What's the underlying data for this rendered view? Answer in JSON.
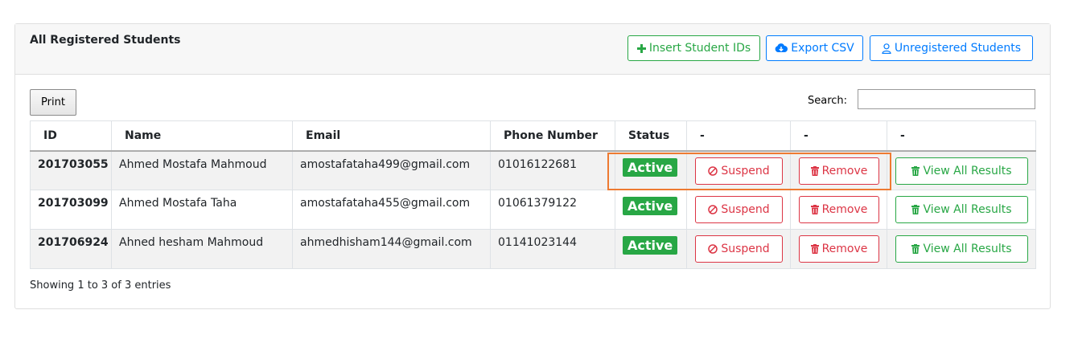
{
  "header": {
    "title": "All Registered Students",
    "buttons": {
      "insert": "Insert Student IDs",
      "export": "Export CSV",
      "unregistered": "Unregistered Students"
    }
  },
  "toolbar": {
    "print": "Print",
    "search_label": "Search:",
    "search_value": ""
  },
  "table": {
    "columns": [
      "ID",
      "Name",
      "Email",
      "Phone Number",
      "Status",
      "-",
      "-",
      "-"
    ],
    "rows": [
      {
        "id": "201703055",
        "name": "Ahmed Mostafa Mahmoud",
        "email": "amostafataha499@gmail.com",
        "phone": "01016122681",
        "status": "Active",
        "suspend": "Suspend",
        "remove": "Remove",
        "view": "View All Results"
      },
      {
        "id": "201703099",
        "name": "Ahmed Mostafa Taha",
        "email": "amostafataha455@gmail.com",
        "phone": "01061379122",
        "status": "Active",
        "suspend": "Suspend",
        "remove": "Remove",
        "view": "View All Results"
      },
      {
        "id": "201706924",
        "name": "Ahned hesham Mahmoud",
        "email": "ahmedhisham144@gmail.com",
        "phone": "01141023144",
        "status": "Active",
        "suspend": "Suspend",
        "remove": "Remove",
        "view": "View All Results"
      }
    ]
  },
  "footer": {
    "info": "Showing 1 to 3 of 3 entries"
  },
  "colors": {
    "success": "#28a745",
    "danger": "#dc3545",
    "primary": "#007bff",
    "highlight": "#ee7a31"
  }
}
